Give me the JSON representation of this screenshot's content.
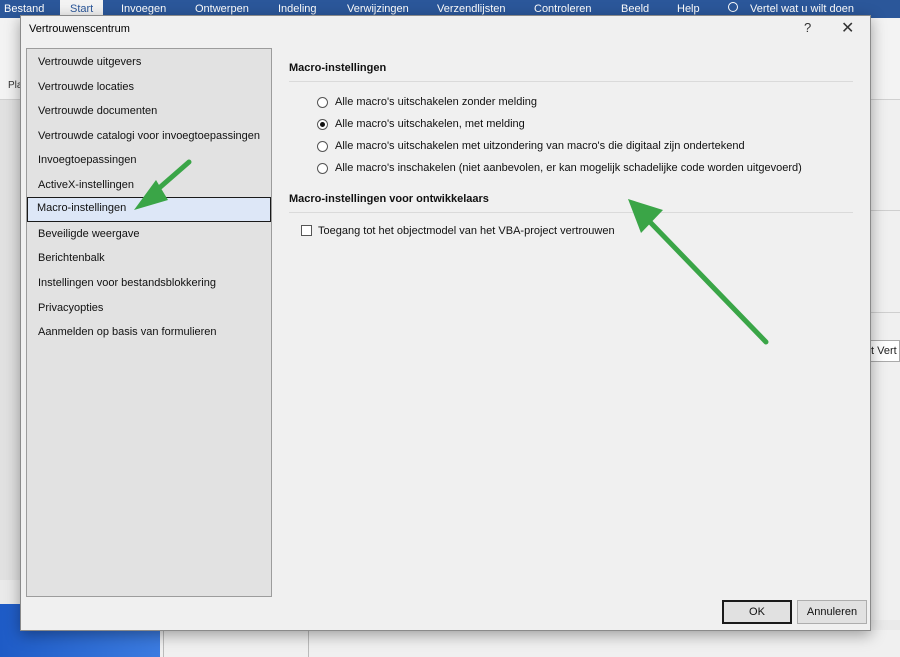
{
  "ribbon": {
    "tabs": [
      "Bestand",
      "Start",
      "Invoegen",
      "Ontwerpen",
      "Indeling",
      "Verwijzingen",
      "Verzendlijsten",
      "Controleren",
      "Beeld",
      "Help"
    ],
    "tell_me": "Vertel wat u wilt doen",
    "group_partial": "Pla"
  },
  "background": {
    "right_partial_label": "t Vert"
  },
  "dialog": {
    "title": "Vertrouwenscentrum",
    "help": "?",
    "close": "✕",
    "sidebar_items": [
      "Vertrouwde uitgevers",
      "Vertrouwde locaties",
      "Vertrouwde documenten",
      "Vertrouwde catalogi voor invoegtoepassingen",
      "Invoegtoepassingen",
      "ActiveX-instellingen",
      "Macro-instellingen",
      "Beveiligde weergave",
      "Berichtenbalk",
      "Instellingen voor bestandsblokkering",
      "Privacyopties",
      "Aanmelden op basis van formulieren"
    ],
    "selected_item": "Macro-instellingen",
    "macro_section": {
      "title": "Macro-instellingen",
      "options": [
        "Alle macro's uitschakelen zonder melding",
        "Alle macro's uitschakelen, met melding",
        "Alle macro's uitschakelen met uitzondering van macro's die digitaal zijn ondertekend",
        "Alle macro's inschakelen (niet aanbevolen, er kan mogelijk schadelijke code worden uitgevoerd)"
      ],
      "selected_option": "Alle macro's uitschakelen, met melding"
    },
    "dev_section": {
      "title": "Macro-instellingen voor ontwikkelaars",
      "checkbox_label": "Toegang tot het objectmodel van het VBA-project vertrouwen",
      "checked": false
    },
    "ok_label": "OK",
    "cancel_label": "Annuleren"
  },
  "colors": {
    "ribbon": "#2b579a",
    "annotation_arrow": "#3aa547",
    "selection": "#dde7f7"
  }
}
